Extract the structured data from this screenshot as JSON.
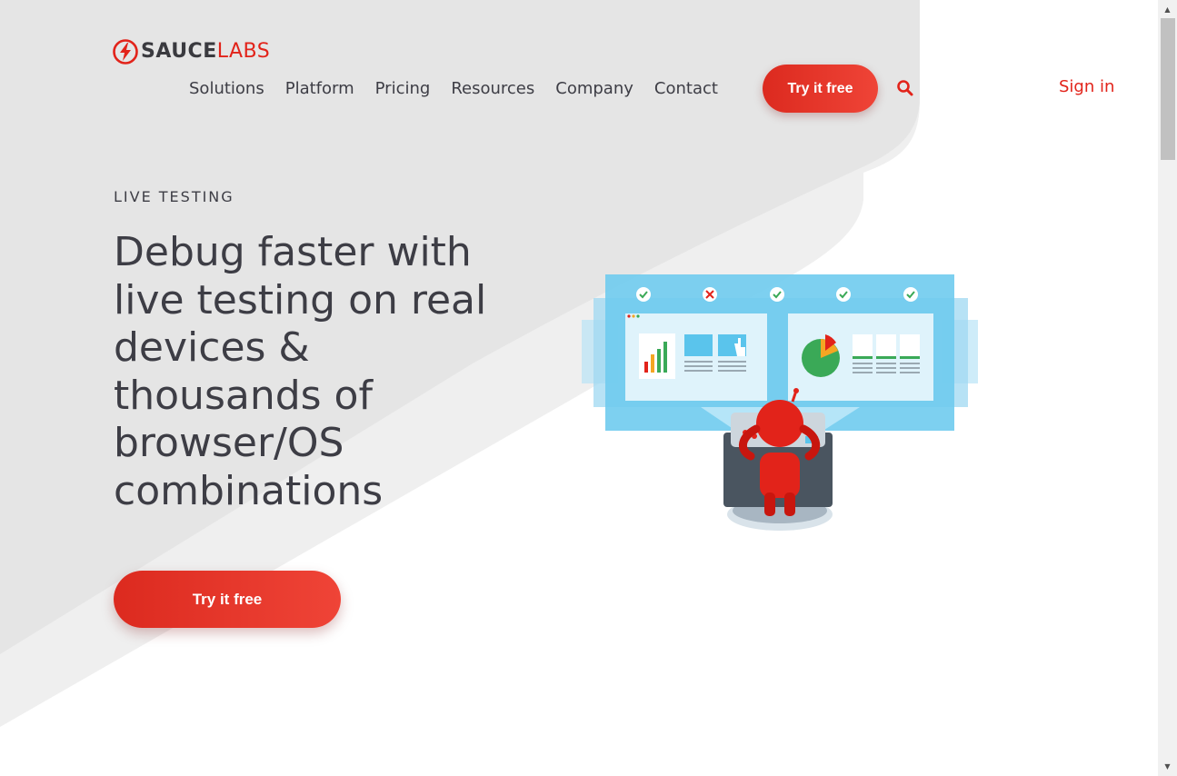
{
  "brand": {
    "name_bold": "SAUCE",
    "name_light": "LABS",
    "accent": "#e2231a"
  },
  "nav": {
    "items": [
      "Solutions",
      "Platform",
      "Pricing",
      "Resources",
      "Company",
      "Contact"
    ],
    "cta_label": "Try it free",
    "search_icon": "search-icon",
    "signin_label": "Sign in"
  },
  "hero": {
    "eyebrow": "LIVE TESTING",
    "headline": "Debug faster with live testing on real devices & thousands of browser/OS combinations",
    "cta_label": "Try it free",
    "illustration_icon": "robot-testing-dashboard-illustration"
  },
  "colors": {
    "cta_start": "#dc2a1f",
    "cta_end": "#ef4437",
    "text": "#3d3d45",
    "bg_gray": "#e6e6e6"
  }
}
